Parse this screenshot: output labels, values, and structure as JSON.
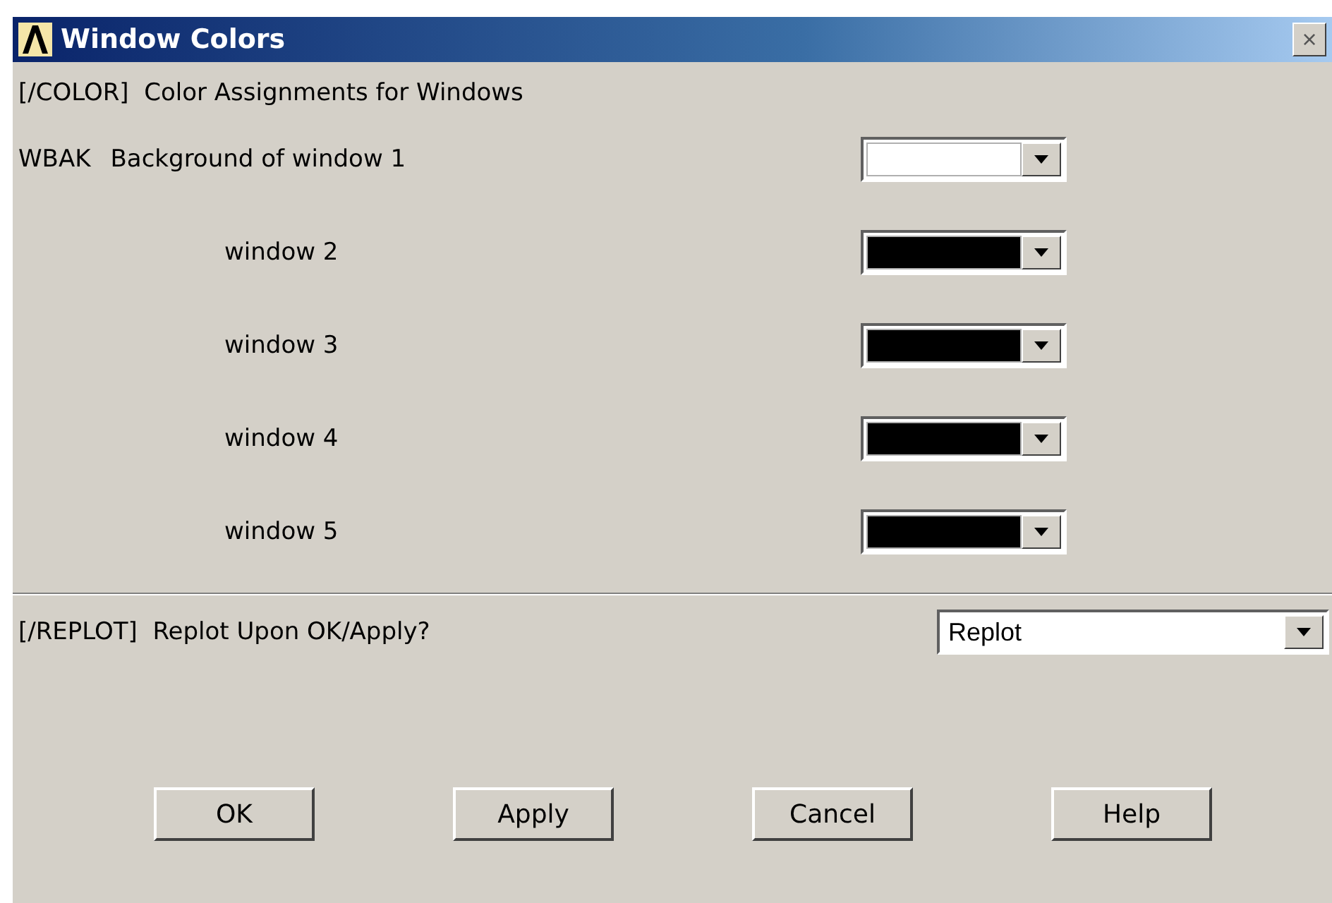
{
  "window": {
    "title": "Window Colors",
    "close": "×"
  },
  "heading": "[/COLOR]  Color Assignments for Windows",
  "color_rows": [
    {
      "command": "WBAK",
      "label": "Background of window 1",
      "color": "#ffffff"
    },
    {
      "label": "window 2",
      "color": "#000000"
    },
    {
      "label": "window 3",
      "color": "#000000"
    },
    {
      "label": "window 4",
      "color": "#000000"
    },
    {
      "label": "window 5",
      "color": "#000000"
    }
  ],
  "replot": {
    "label": "[/REPLOT]  Replot Upon OK/Apply?",
    "value": "Replot"
  },
  "buttons": [
    "OK",
    "Apply",
    "Cancel",
    "Help"
  ]
}
